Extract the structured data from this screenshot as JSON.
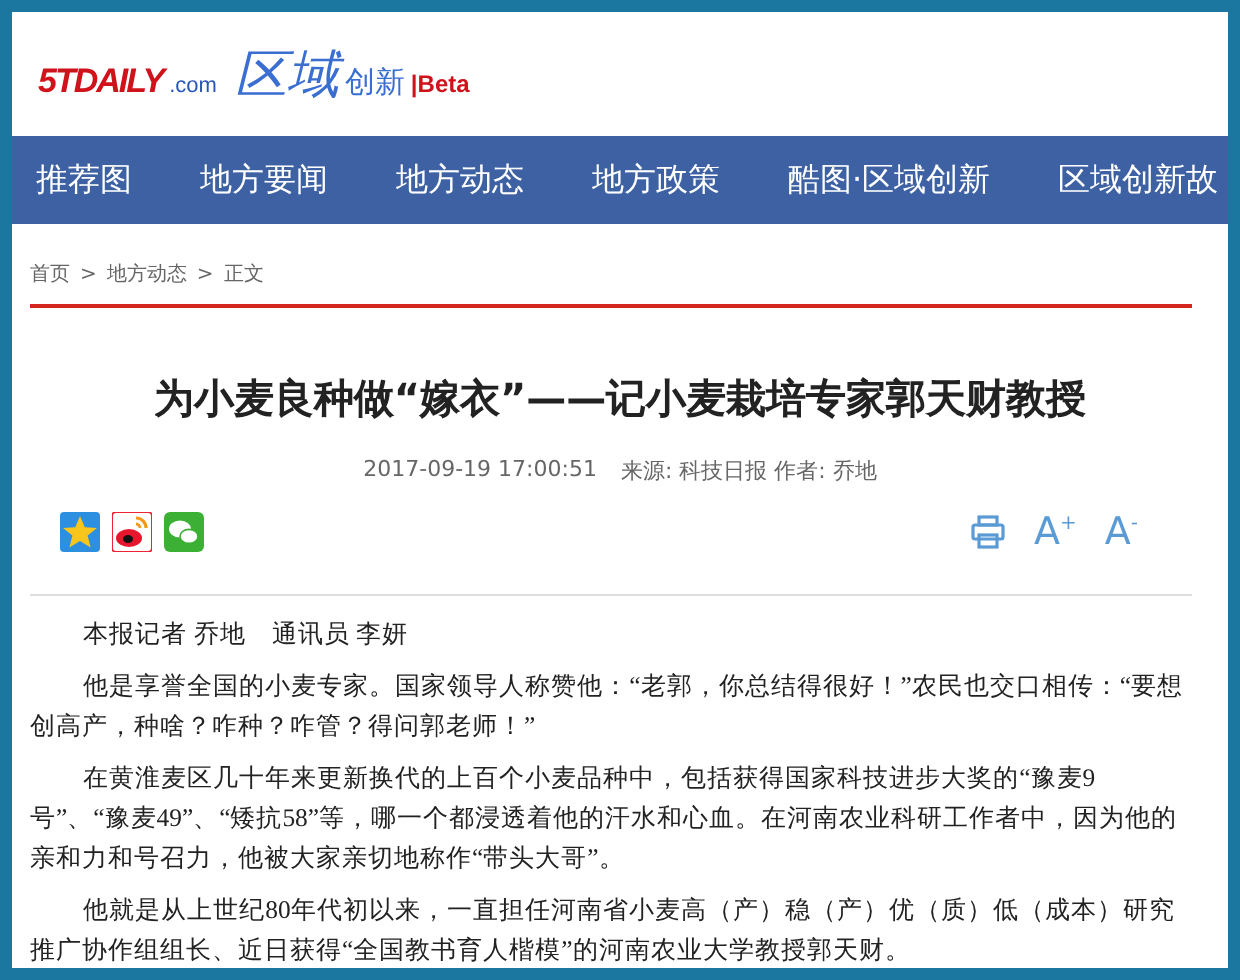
{
  "logo": {
    "site": "5TDAILY",
    "domain": ".com",
    "brand": "区域",
    "sub": "创新",
    "beta": "|Beta"
  },
  "nav": [
    {
      "label": "推荐图",
      "selected": false
    },
    {
      "label": "地方要闻",
      "selected": false
    },
    {
      "label": "地方动态",
      "selected": false
    },
    {
      "label": "地方政策",
      "selected": false
    },
    {
      "label": "酷图·区域创新",
      "selected": false
    },
    {
      "label": "区域创新故",
      "selected": false
    }
  ],
  "breadcrumb": [
    "首页",
    "地方动态",
    "正文"
  ],
  "breadcrumb_separator": ">",
  "article": {
    "title": "为小麦良种做“嫁衣”——记小麦栽培专家郭天财教授",
    "datetime": "2017-09-19 17:00:51",
    "source": "来源: 科技日报 作者: 乔地",
    "share": [
      {
        "kind": "qzone"
      },
      {
        "kind": "weibo"
      },
      {
        "kind": "wechat"
      }
    ],
    "tools": [
      {
        "kind": "print"
      },
      {
        "kind": "text",
        "label": "A$^{+}$"
      },
      {
        "kind": "text",
        "label": "A$^{-}$"
      }
    ],
    "byline": "本报记者 乔地　通讯员 李妍",
    "paragraphs": [
      "他是享誉全国的小麦专家。国家领导人称赞他：“老郭，你总结得很好！”农民也交口相传：“要想创高产，种啥？咋种？咋管？得问郭老师！”",
      "在黄淮麦区几十年来更新换代的上百个小麦品种中，包括获得国家科技进步大奖的“豫麦9号”、“豫麦49”、“矮抗58”等，哪一个都浸透着他的汗水和心血。在河南农业科研工作者中，因为他的亲和力和号召力，他被大家亲切地称作“带头大哥”。",
      "他就是从上世纪80年代初以来，一直担任河南省小麦高（产）稳（产）优（质）低（成本）研究推广协作组组长、近日获得“全国教书育人楷模”的河南农业大学教授郭天财。"
    ]
  }
}
